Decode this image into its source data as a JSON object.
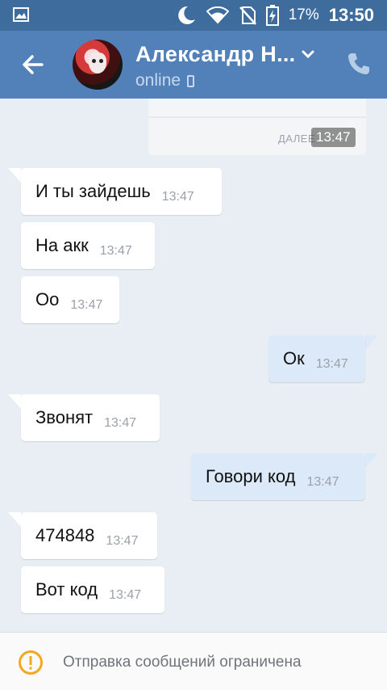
{
  "status_bar": {
    "battery_percent": "17%",
    "time": "13:50",
    "icons": [
      "gallery-icon",
      "moon-icon",
      "wifi-icon",
      "no-sim-icon",
      "battery-charging-icon"
    ]
  },
  "header": {
    "contact_name": "Александр Н...",
    "status": "online",
    "icons": [
      "back-arrow-icon",
      "chevron-down-icon",
      "phone-icon",
      "mobile-device-icon"
    ]
  },
  "forwarded": {
    "more_label": "ДАЛЕЕ",
    "time": "13:47"
  },
  "messages": [
    {
      "direction": "in",
      "text": "И ты зайдешь",
      "time": "13:47"
    },
    {
      "direction": "in",
      "text": "На акк",
      "time": "13:47"
    },
    {
      "direction": "in",
      "text": "Оо",
      "time": "13:47"
    },
    {
      "direction": "out",
      "text": "Ок",
      "time": "13:47"
    },
    {
      "direction": "in",
      "text": "Звонят",
      "time": "13:47"
    },
    {
      "direction": "out",
      "text": "Говори код",
      "time": "13:47"
    },
    {
      "direction": "in",
      "text": "474848",
      "time": "13:47"
    },
    {
      "direction": "in",
      "text": "Вот код",
      "time": "13:47"
    }
  ],
  "footer": {
    "restriction_text": "Отправка сообщений ограничена",
    "icon": "warning-icon"
  },
  "colors": {
    "header": "#5181b8",
    "status_bar": "#3e6c9c",
    "incoming_bubble": "#ffffff",
    "outgoing_bubble": "#dbe9f8",
    "warning": "#f5a623"
  }
}
